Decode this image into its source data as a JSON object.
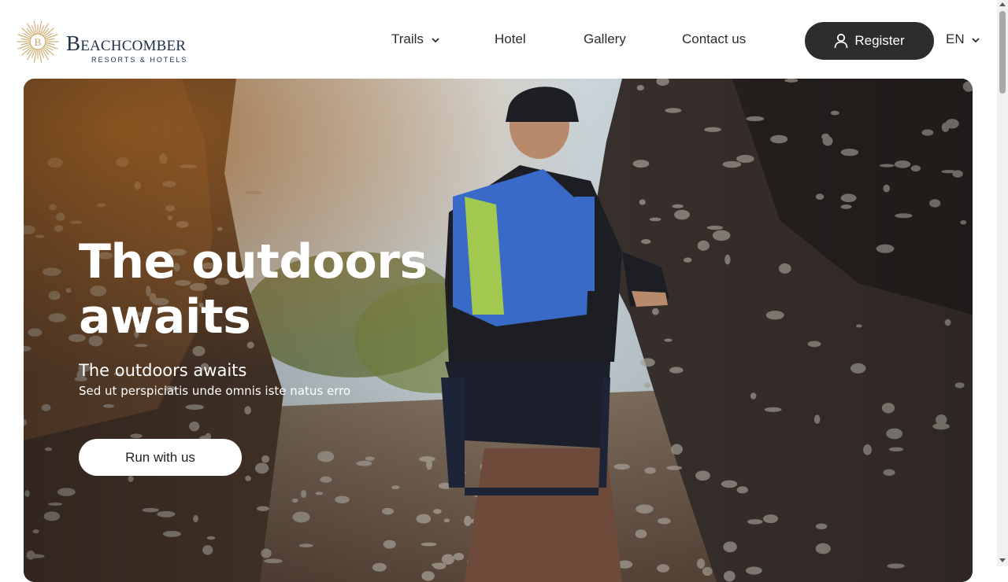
{
  "brand": {
    "name": "Beachcomber",
    "tagline": "RESORTS & HOTELS",
    "emblem_letter": "B",
    "gold": "#c8a25e",
    "navy": "#1e3045"
  },
  "nav": {
    "items": [
      {
        "label": "Trails",
        "has_dropdown": true
      },
      {
        "label": "Hotel",
        "has_dropdown": false
      },
      {
        "label": "Gallery",
        "has_dropdown": false
      },
      {
        "label": "Contact us",
        "has_dropdown": false
      }
    ],
    "register_label": "Register",
    "register_icon": "user-icon",
    "language": "EN"
  },
  "hero": {
    "title": "The outdoors awaits",
    "subtitle": "The outdoors awaits",
    "description": "Sed ut perspiciatis unde omnis iste natus erro",
    "cta_label": "Run with us"
  },
  "colors": {
    "button_dark": "#2d2d2d",
    "text": "#2b2b2b"
  }
}
